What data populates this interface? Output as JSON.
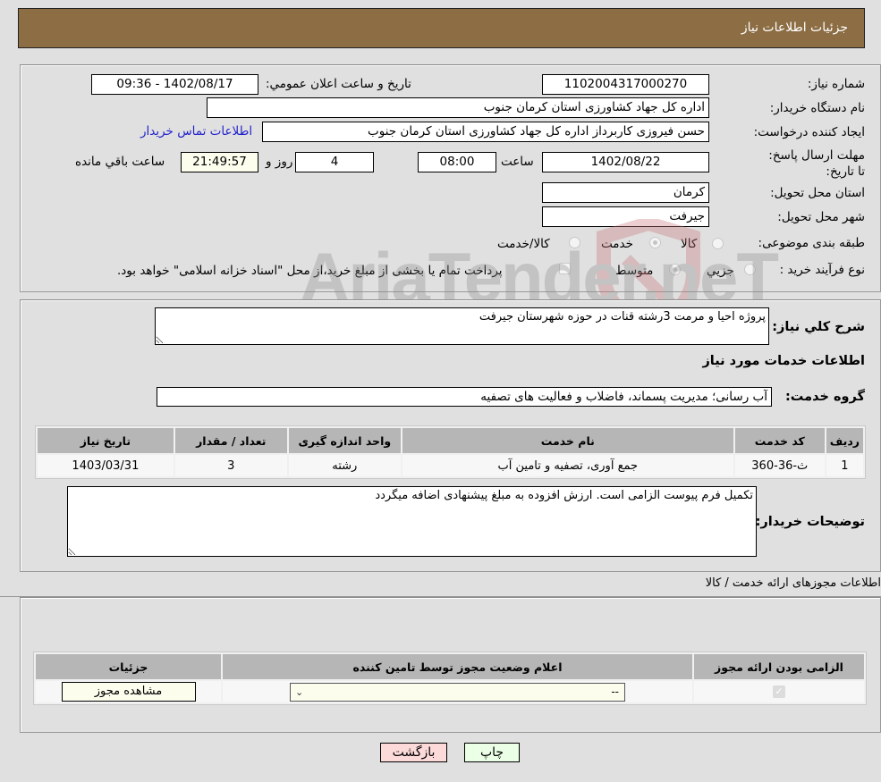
{
  "header": {
    "title": "جزئیات اطلاعات نیاز"
  },
  "details": {
    "need_number_label": "شماره نیاز:",
    "need_number": "1102004317000270",
    "announce_label": "تاریخ و ساعت اعلان عمومي:",
    "announce_value": "1402/08/17 - 09:36",
    "buyer_org_label": "نام دستگاه خریدار:",
    "buyer_org": "اداره کل جهاد کشاورزی استان کرمان   جنوب",
    "creator_label": "ایجاد کننده درخواست:",
    "creator": "حسن فیروزی کاربرداز اداره کل جهاد کشاورزی استان کرمان   جنوب",
    "contact_link": "اطلاعات تماس خریدار",
    "deadline_label": "مهلت ارسال پاسخ: تا تاریخ:",
    "deadline_date": "1402/08/22",
    "time_label": "ساعت",
    "deadline_time": "08:00",
    "days_value": "4",
    "days_label": "روز و",
    "remaining_time": "21:49:57",
    "remaining_label": "ساعت باقي مانده",
    "province_label": "استان محل تحویل:",
    "province": "کرمان",
    "city_label": "شهر محل تحویل:",
    "city": "جیرفت",
    "category_label": "طبقه بندی موضوعی:",
    "category_options": [
      {
        "label": "کالا",
        "checked": false
      },
      {
        "label": "خدمت",
        "checked": true
      },
      {
        "label": "کالا/خدمت",
        "checked": false
      }
    ],
    "process_label": "نوع فرآیند خرید :",
    "process_options": [
      {
        "label": "جزيي",
        "checked": false
      },
      {
        "label": "متوسط",
        "checked": true
      }
    ],
    "treasury_note": "پرداخت تمام یا بخشی از مبلغ خرید،از محل \"اسناد خزانه اسلامی\" خواهد بود.",
    "treasury_checked": false
  },
  "services": {
    "summary_label": "شرح کلي نیاز:",
    "summary": "پروژه احیا و مرمت 3رشته قنات در حوزه شهرستان جیرفت",
    "section_title": "اطلاعات خدمات مورد نیاز",
    "group_label": "گروه خدمت:",
    "group_value": "آب رسانی؛ مدیریت پسماند، فاضلاب و فعالیت های تصفیه",
    "table": {
      "headers": [
        "ردیف",
        "کد خدمت",
        "نام خدمت",
        "واحد اندازه گیری",
        "تعداد / مقدار",
        "تاریخ نیاز"
      ],
      "rows": [
        [
          "1",
          "ث-36-360",
          "جمع آوری، تصفیه و تامین آب",
          "رشته",
          "3",
          "1403/03/31"
        ]
      ]
    },
    "buyer_notes_label": "توضیحات خریدار:",
    "buyer_notes": "تکمیل فرم پیوست الزامی است. ارزش افزوده به مبلغ پیشنهادی اضافه میگردد"
  },
  "permits": {
    "section_title": "اطلاعات مجوزهای ارائه خدمت / کالا",
    "headers": [
      "الزامی بودن ارائه مجوز",
      "اعلام وضعیت مجوز توسط تامین کننده",
      "جزئیات"
    ],
    "row": {
      "required_checked": true,
      "status_value": "--",
      "details_button": "مشاهده مجوز"
    }
  },
  "footer": {
    "print_button": "چاپ",
    "back_button": "بازگشت"
  },
  "watermark": {
    "text": "AriaTender.neT"
  }
}
